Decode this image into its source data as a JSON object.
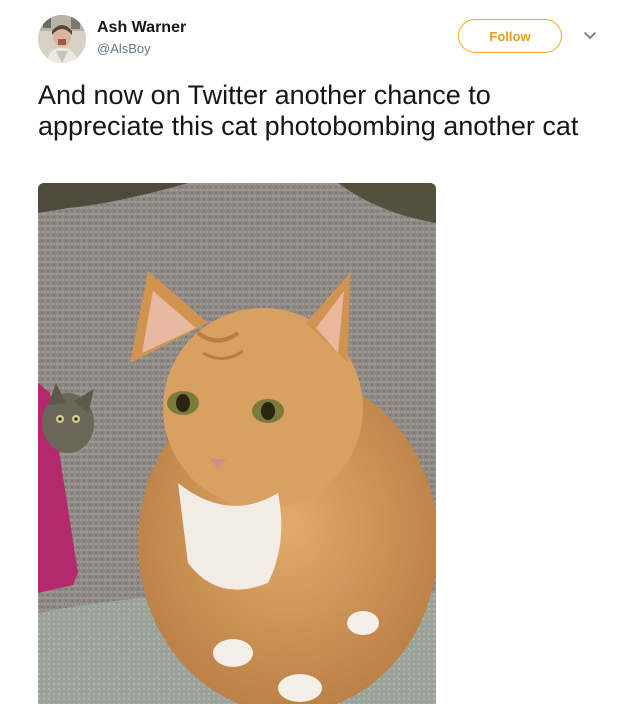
{
  "tweet": {
    "author": {
      "name": "Ash Warner",
      "handle": "@AlsBoy",
      "avatar_icon": "user-avatar"
    },
    "follow_label": "Follow",
    "menu_icon": "chevron-down-icon",
    "text": "And now on Twitter another chance to appreciate this cat photobombing another cat",
    "media": {
      "kind": "photo",
      "subject": "orange-tabby-cat-with-tabby-kitten-peeking",
      "colors": {
        "carpet": "#8e8984",
        "cat": "#d39a5a"
      }
    }
  },
  "colors": {
    "follow_accent": "#f5a623",
    "text": "#14171a",
    "secondary_text": "#657786"
  }
}
